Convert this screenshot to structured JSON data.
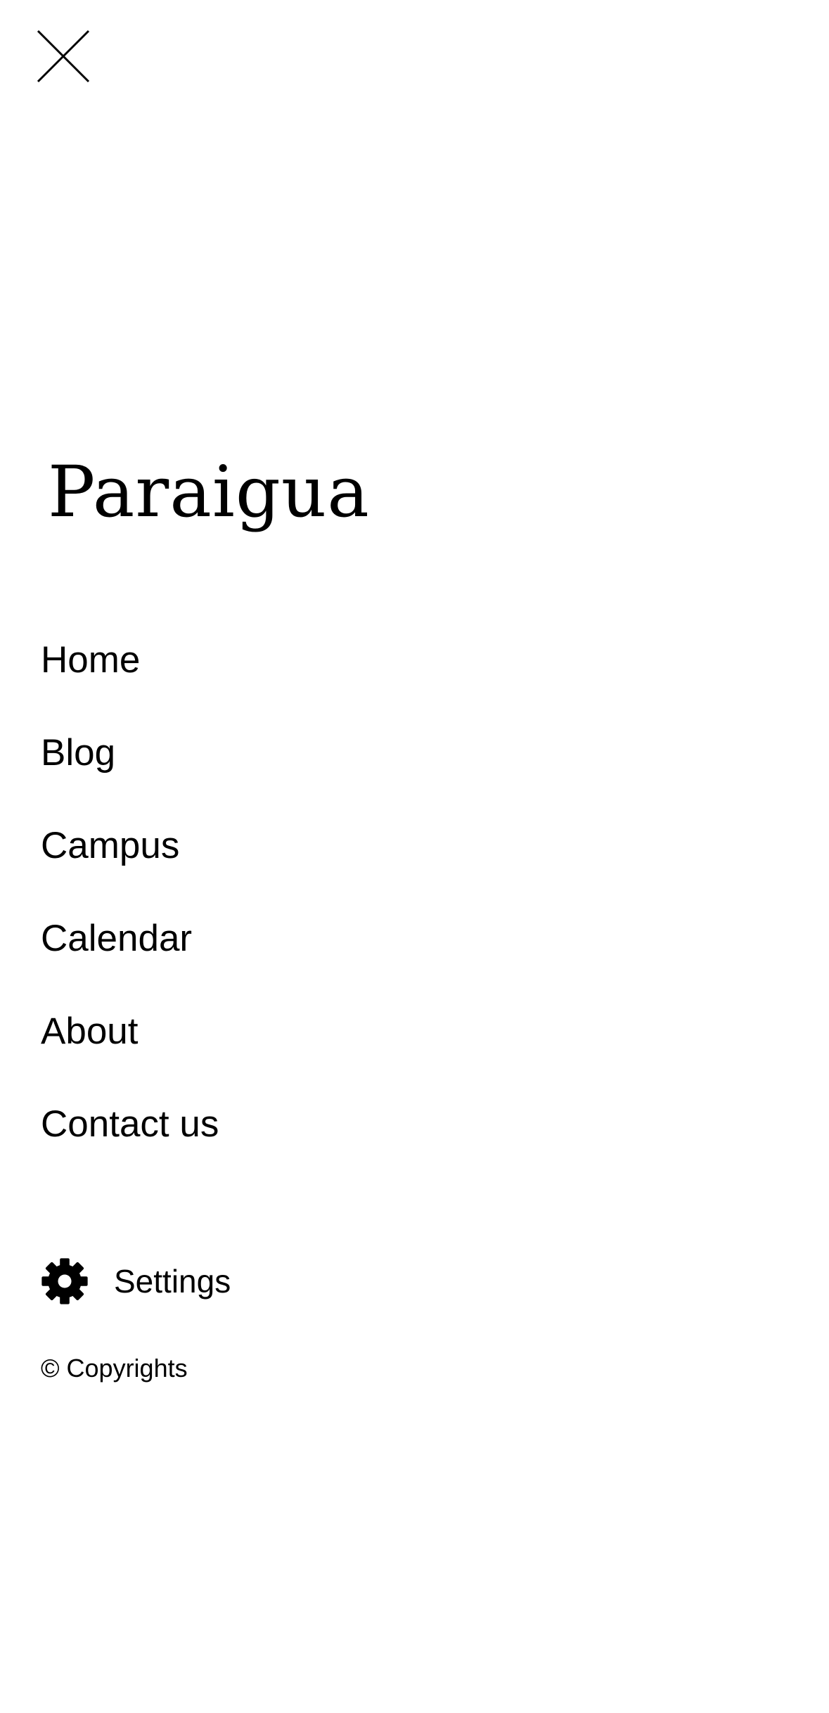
{
  "menu": {
    "brand": "Paraigua",
    "close_icon": "close-icon",
    "items": [
      {
        "label": "Home"
      },
      {
        "label": "Blog"
      },
      {
        "label": "Campus"
      },
      {
        "label": "Calendar"
      },
      {
        "label": "About"
      },
      {
        "label": "Contact us"
      }
    ],
    "settings": {
      "icon": "gear-icon",
      "label": "Settings"
    },
    "copyright": "© Copyrights"
  }
}
